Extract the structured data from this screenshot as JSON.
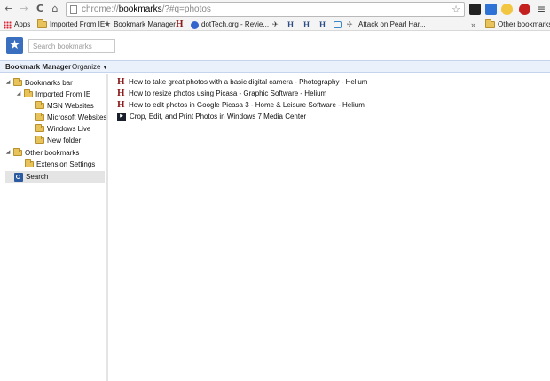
{
  "browser": {
    "url_prefix": "chrome://",
    "url_host": "bookmarks",
    "url_path": "/?#q=photos",
    "back_glyph": "←",
    "forward_glyph": "→",
    "reload_glyph": "C",
    "home_glyph": "⌂",
    "star_glyph": "☆",
    "menu_glyph": "≡"
  },
  "bookmarks_bar": {
    "apps": "Apps",
    "items": [
      {
        "label": "Imported From IE",
        "icon": "folder-icon"
      },
      {
        "label": "Bookmark Manager",
        "icon": "star-icon"
      },
      {
        "label": "dotTech.org - Revie...",
        "icon": "dottech-icon"
      },
      {
        "label": "Attack on Pearl Har...",
        "icon": "bird-icon"
      }
    ],
    "overflow": "»",
    "other": "Other bookmarks"
  },
  "manager": {
    "search_placeholder": "Search bookmarks",
    "title": "Bookmark Manager",
    "organize": "Organize"
  },
  "tree": {
    "bookmarks_bar": "Bookmarks bar",
    "imported": "Imported From IE",
    "msn": "MSN Websites",
    "microsoft": "Microsoft Websites",
    "windows_live": "Windows Live",
    "new_folder": "New folder",
    "other": "Other bookmarks",
    "extension_settings": "Extension Settings",
    "search": "Search"
  },
  "results": [
    {
      "title": "How to take great photos with a basic digital camera - Photography - Helium",
      "icon": "helium-icon"
    },
    {
      "title": "How to resize photos using Picasa - Graphic Software - Helium",
      "icon": "helium-icon"
    },
    {
      "title": "How to edit photos in Google Picasa 3 - Home & Leisure Software - Helium",
      "icon": "helium-icon"
    },
    {
      "title": "Crop, Edit, and Print Photos in Windows 7 Media Center",
      "icon": "media-center-icon"
    }
  ],
  "colors": {
    "accent": "#3a6fbf",
    "selection": "#e4e4e4",
    "header_band": "#eaf1fb"
  }
}
